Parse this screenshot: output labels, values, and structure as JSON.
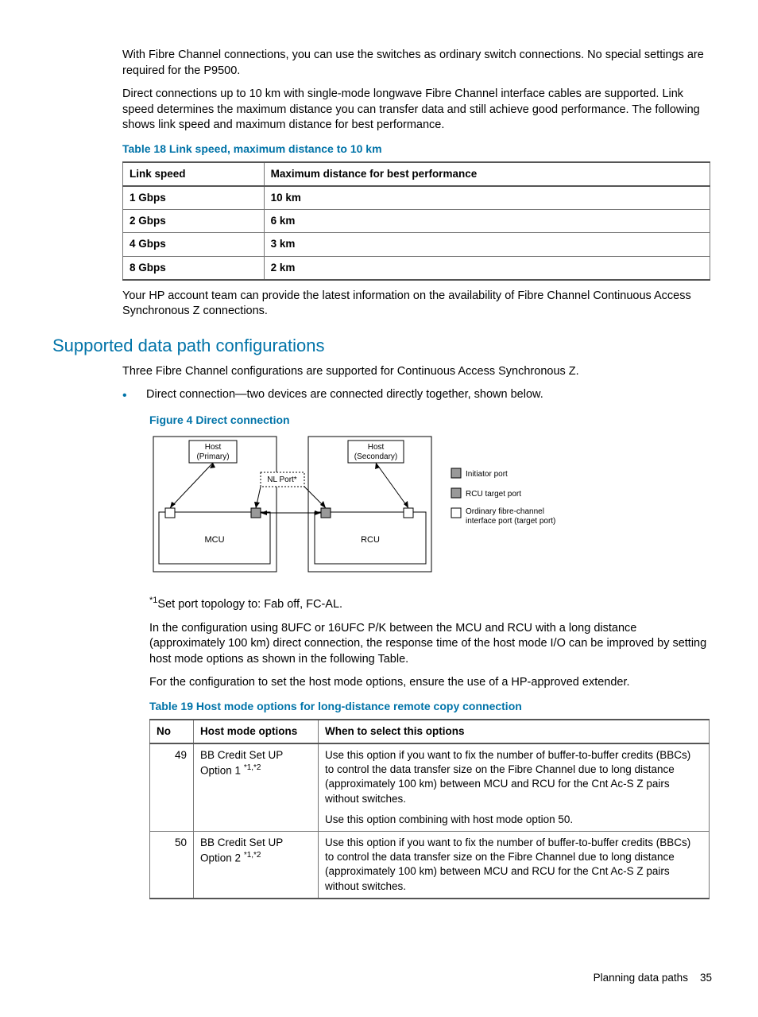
{
  "intro1": "With Fibre Channel connections, you can use the switches as ordinary switch connections. No special settings are required for the P9500.",
  "intro2": "Direct connections up to 10 km with single-mode longwave Fibre Channel interface cables are supported. Link speed determines the maximum distance you can transfer data and still achieve good performance. The following shows link speed and maximum distance for best performance.",
  "table18": {
    "caption": "Table 18 Link speed, maximum distance to 10 km",
    "headers": [
      "Link speed",
      "Maximum distance for best performance"
    ],
    "rows": [
      [
        "1 Gbps",
        "10 km"
      ],
      [
        "2 Gbps",
        "6 km"
      ],
      [
        "4 Gbps",
        "3 km"
      ],
      [
        "8 Gbps",
        "2 km"
      ]
    ]
  },
  "after18": "Your HP account team can provide the latest information on the availability of Fibre Channel Continuous Access Synchronous Z connections.",
  "h2": "Supported data path configurations",
  "h2_intro": "Three Fibre Channel configurations are supported for Continuous Access Synchronous Z.",
  "bullet1": "Direct connection—two devices are connected directly together, shown below.",
  "figure4": {
    "caption": "Figure 4 Direct connection",
    "host_primary": "Host (Primary)",
    "host_secondary": "Host (Secondary)",
    "nl_port": "NL Port*",
    "mcu": "MCU",
    "rcu": "RCU",
    "legend1": "Initiator port",
    "legend2": "RCU target port",
    "legend3": "Ordinary fibre-channel interface port (target port)"
  },
  "footnote1_pre": "*1",
  "footnote1": "Set port topology to: Fab off, FC-AL.",
  "para_8ufc": "In the configuration using 8UFC or 16UFC P/K between the MCU and RCU with a long distance (approximately 100 km) direct connection, the response time of the host mode I/O can be improved by setting host mode options as shown in the following Table.",
  "para_extender": "For the configuration to set the host mode options, ensure the use of a HP-approved extender.",
  "table19": {
    "caption": "Table 19 Host mode options for long-distance remote copy connection",
    "headers": [
      "No",
      "Host mode options",
      "When to select this options"
    ],
    "rows": [
      {
        "no": "49",
        "opt_name": "BB Credit Set UP Option 1",
        "opt_sup": "*1,*2",
        "desc1": "Use this option if you want to fix the number of buffer-to-buffer credits (BBCs) to control the data transfer size on the Fibre Channel due to long distance (approximately 100 km) between MCU and RCU for the Cnt Ac-S Z pairs without switches.",
        "desc2": "Use this option combining with host mode option 50."
      },
      {
        "no": "50",
        "opt_name": "BB Credit Set UP Option 2",
        "opt_sup": "*1,*2",
        "desc1": "Use this option if you want to fix the number of buffer-to-buffer credits (BBCs) to control the data transfer size on the Fibre Channel due to long distance (approximately 100 km) between MCU and RCU for the Cnt Ac-S Z pairs without switches.",
        "desc2": ""
      }
    ]
  },
  "footer_text": "Planning data paths",
  "footer_page": "35",
  "chart_data": {
    "type": "table",
    "title": "Link speed, maximum distance to 10 km",
    "columns": [
      "Link speed",
      "Maximum distance for best performance"
    ],
    "rows": [
      [
        "1 Gbps",
        "10 km"
      ],
      [
        "2 Gbps",
        "6 km"
      ],
      [
        "4 Gbps",
        "3 km"
      ],
      [
        "8 Gbps",
        "2 km"
      ]
    ]
  }
}
